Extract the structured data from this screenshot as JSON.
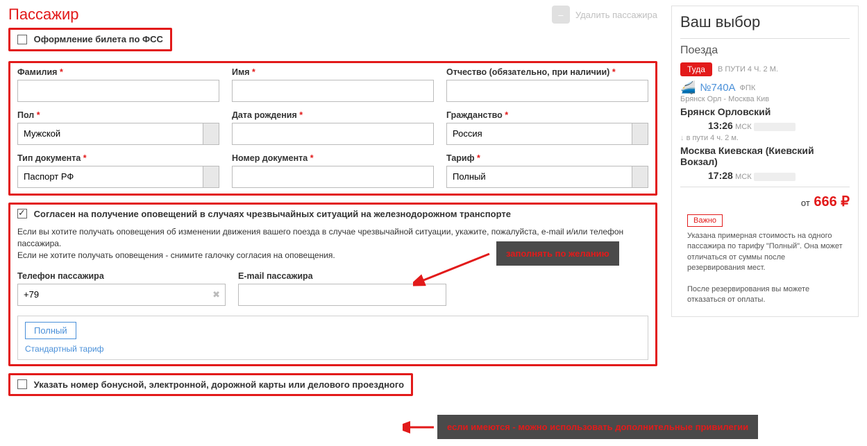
{
  "header": {
    "title": "Пассажир",
    "delete": "Удалить пассажира"
  },
  "fss": {
    "label": "Оформление билета по ФСС"
  },
  "fields": {
    "lastname": {
      "label": "Фамилия"
    },
    "firstname": {
      "label": "Имя"
    },
    "patronymic": {
      "label": "Отчество (обязательно, при наличии)"
    },
    "gender": {
      "label": "Пол",
      "value": "Мужской"
    },
    "dob": {
      "label": "Дата рождения"
    },
    "citizenship": {
      "label": "Гражданство",
      "value": "Россия"
    },
    "doctype": {
      "label": "Тип документа",
      "value": "Паспорт РФ"
    },
    "docnum": {
      "label": "Номер документа"
    },
    "tariff": {
      "label": "Тариф",
      "value": "Полный"
    }
  },
  "notify": {
    "consent": "Согласен на получение оповещений в случаях чрезвычайных ситуаций на железнодорожном транспорте",
    "info1": "Если вы хотите получать оповещения об изменении движения вашего поезда в случае чрезвычайной ситуации, укажите, пожалуйста, e-mail и/или телефон пассажира.",
    "info2": "Если не хотите получать оповещения - снимите галочку согласия на оповещения.",
    "phone_label": "Телефон пассажира",
    "phone_value": "+79",
    "email_label": "E-mail пассажира"
  },
  "tariff_box": {
    "btn": "Полный",
    "link": "Стандартный тариф"
  },
  "bonus": {
    "label": "Указать номер бонусной, электронной, дорожной карты или делового проездного"
  },
  "anno": {
    "a1": "заполнять по желанию",
    "a2": "если имеются - можно использовать дополнительные привилегии"
  },
  "side": {
    "title": "Ваш выбор",
    "sub": "Поезда",
    "dir": "Туда",
    "travel": "В ПУТИ 4 Ч. 2 М.",
    "train_no": "№740А",
    "carrier": "ФПК",
    "route": "Брянск Орл - Москва Кив",
    "from_station": "Брянск Орловский",
    "from_time": "13:26",
    "tz": "МСК",
    "transit": "в пути  4 ч. 2 м.",
    "to_station": "Москва Киевская (Киевский Вокзал)",
    "to_time": "17:28",
    "price_from": "от",
    "price": "666 ₽",
    "important": "Важно",
    "note1": "Указана примерная стоимость на одного пассажира по тарифу \"Полный\". Она может отличаться от суммы после резервирования мест.",
    "note2": "После резервирования вы можете отказаться от оплаты."
  }
}
